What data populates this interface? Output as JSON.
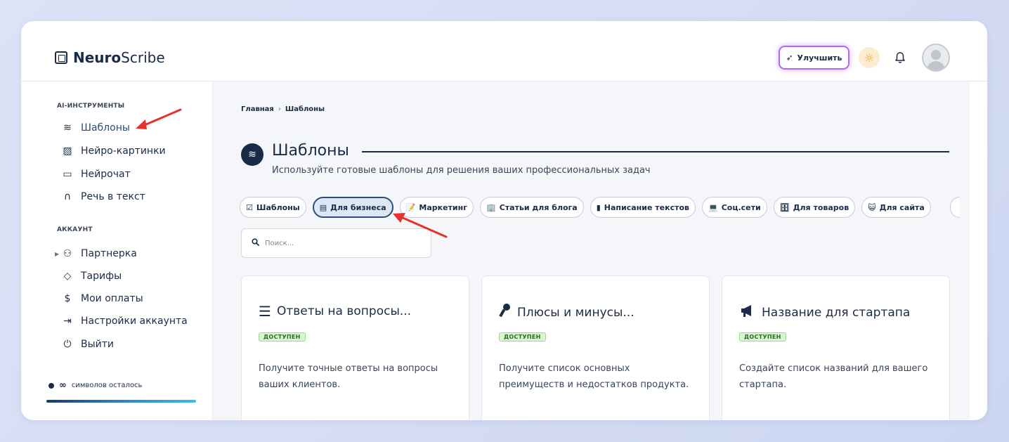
{
  "app": {
    "logo_bold": "Neuro",
    "logo_light": "Scribe"
  },
  "header": {
    "upgrade_label": "Улучшить"
  },
  "sidebar": {
    "section_tools": "AI-ИНСТРУМЕНТЫ",
    "tools": [
      {
        "label": "Шаблоны",
        "icon": "layers-icon"
      },
      {
        "label": "Нейро-картинки",
        "icon": "image-icon"
      },
      {
        "label": "Нейрочат",
        "icon": "chat-icon"
      },
      {
        "label": "Речь в текст",
        "icon": "headphones-icon"
      }
    ],
    "section_account": "АККАУНТ",
    "account": [
      {
        "label": "Партнерка",
        "icon": "users-icon"
      },
      {
        "label": "Тарифы",
        "icon": "tag-icon"
      },
      {
        "label": "Мои оплаты",
        "icon": "dollar-icon"
      },
      {
        "label": "Настройки аккаунта",
        "icon": "login-icon"
      },
      {
        "label": "Выйти",
        "icon": "power-icon"
      }
    ],
    "chars_value": "∞",
    "chars_label": "символов осталось",
    "chars_progress": 1.0
  },
  "main": {
    "breadcrumb": {
      "home": "Главная",
      "sep": "›",
      "current": "Шаблоны"
    },
    "title": "Шаблоны",
    "subtitle": "Используйте готовые шаблоны для решения ваших профессиональных задач",
    "chips": [
      {
        "label": "Шаблоны",
        "icon": "☑"
      },
      {
        "label": "Для бизнеса",
        "icon": "▤"
      },
      {
        "label": "Маркетинг",
        "icon": "📝"
      },
      {
        "label": "Статьи для блога",
        "icon": "🏢"
      },
      {
        "label": "Написание текстов",
        "icon": "▮"
      },
      {
        "label": "Соц.сети",
        "icon": "💻"
      },
      {
        "label": "Для товаров",
        "icon": "🗄"
      },
      {
        "label": "Для сайта",
        "icon": "😺"
      }
    ],
    "active_chip": "Для бизнеса",
    "search_placeholder": "Поиск...",
    "cards": [
      {
        "title": "Ответы на вопросы...",
        "badge": "ДОСТУПЕН",
        "desc": "Получите точные ответы на вопросы ваших клиентов.",
        "icon": "list-icon"
      },
      {
        "title": "Плюсы и минусы...",
        "badge": "ДОСТУПЕН",
        "desc": "Получите список основных преимуществ и недостатков продукта.",
        "icon": "key-icon"
      },
      {
        "title": "Название для стартапа",
        "badge": "ДОСТУПЕН",
        "desc": "Создайте список названий для вашего стартапа.",
        "icon": "megaphone-icon"
      }
    ]
  },
  "colors": {
    "accent_dark": "#1a2b47",
    "upgrade_glow": "#b168f6",
    "badge_green": "#d9f5d4",
    "annotation_red": "#e5322d"
  }
}
